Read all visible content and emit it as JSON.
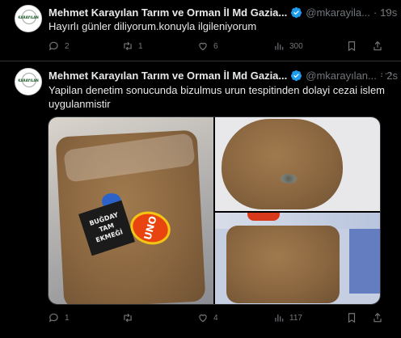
{
  "tweets": [
    {
      "author_name": "Mehmet Karayılan Tarım ve Orman İl Md Gazia...",
      "handle": "@mkarayila...",
      "time": "19s",
      "text": "Hayırlı günler diliyorum.konuyla ilgileniyorum",
      "replies": "2",
      "retweets": "1",
      "likes": "6",
      "views": "300",
      "avatar_text": "KARAYILAN"
    },
    {
      "author_name": "Mehmet Karayılan Tarım ve Orman İl Md Gazia...",
      "handle": "@mkarayılan...",
      "time": "2s",
      "text": "Yapilan denetim sonucunda bizulmus urun tespitinden dolayi cezai islem uygulanmistir",
      "replies": "1",
      "retweets": "",
      "likes": "4",
      "views": "117",
      "avatar_text": "KARAYILAN",
      "media": {
        "label_text": "BUĞDAY TAM EKMEĞİ",
        "brand_text": "UNO"
      }
    }
  ],
  "colors": {
    "background": "#000000",
    "text": "#e7e9ea",
    "muted": "#71767b",
    "verified": "#1d9bf0",
    "divider": "#2f3336"
  },
  "icons": [
    "verified-icon",
    "more-icon",
    "reply-icon",
    "retweet-icon",
    "like-icon",
    "views-icon",
    "bookmark-icon",
    "share-icon"
  ]
}
